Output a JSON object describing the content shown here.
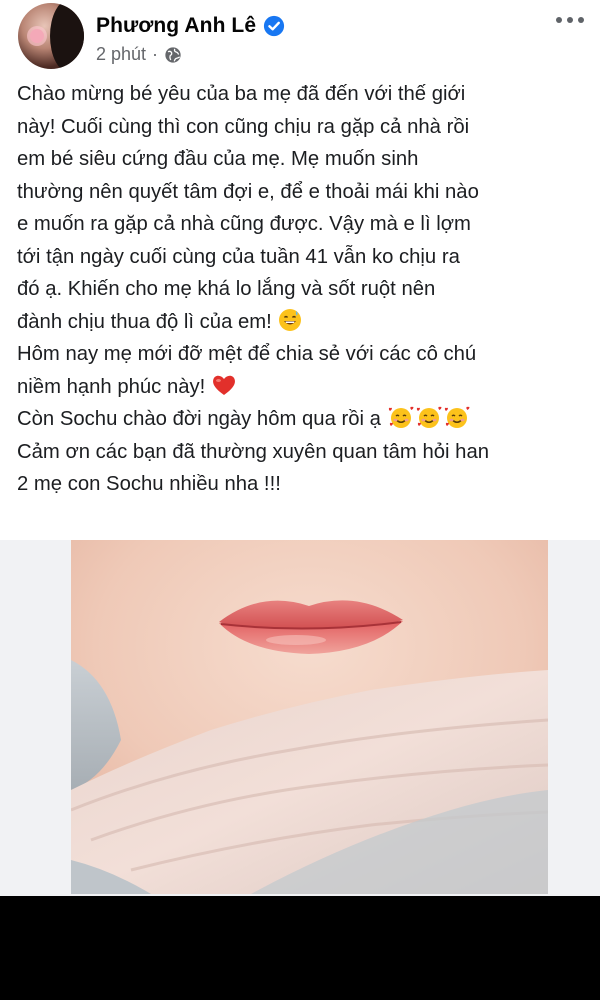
{
  "author": {
    "name": "Phương Anh Lê",
    "verified_icon": "verified-badge-icon",
    "avatar_icon": "profile-avatar"
  },
  "meta": {
    "time": "2 phút",
    "separator": "·",
    "privacy_icon": "globe-icon"
  },
  "menu_icon": "more-options-icon",
  "post": {
    "lines": [
      "Chào mừng bé yêu của ba mẹ đã đến với thế giới",
      "này! Cuối cùng thì con cũng chịu ra gặp cả nhà rồi",
      "em bé siêu cứng đầu của mẹ. Mẹ muốn sinh",
      "thường nên quyết tâm đợi e, để e thoải mái khi nào",
      "e muốn ra gặp cả nhà cũng được. Vậy mà e lì lợm",
      "tới tận ngày cuối cùng của tuần 41 vẫn ko chịu ra",
      "đó ạ. Khiến cho mẹ khá lo lắng và sốt ruột nên",
      "đành chịu thua độ lì của em!",
      "Hôm nay mẹ mới đỡ mệt để chia sẻ với các cô chú",
      "niềm hạnh phúc này!",
      "Còn Sochu chào đời ngày hôm qua rồi ạ",
      "Cảm ơn các bạn đã thường xuyên quan tâm hỏi han",
      "2 mẹ con Sochu nhiều nha !!!"
    ],
    "emojis": {
      "sweat_smile": "grinning-sweat-emoji",
      "heart": "red-heart-emoji",
      "hearts_face": "smiling-face-with-hearts-emoji"
    }
  },
  "photo": {
    "description_icon": "baby-lips-photo"
  },
  "colors": {
    "verified_blue": "#1877f2",
    "text": "#1c1e21",
    "meta_gray": "#65676b"
  }
}
